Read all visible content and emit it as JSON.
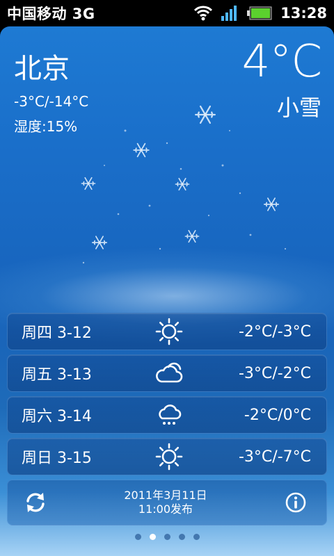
{
  "status_bar": {
    "carrier": "中国移动 3G",
    "time": "13:28",
    "icons": [
      "wifi-icon",
      "signal-icon",
      "battery-icon"
    ]
  },
  "weather": {
    "city": "北京",
    "temp_range": "-3°C/-14°C",
    "humidity": "湿度:15%",
    "current_temp": "4°C",
    "condition": "小雪"
  },
  "forecast": [
    {
      "day": "周四 3-12",
      "icon": "sunny-icon",
      "temp": "-2°C/-3°C"
    },
    {
      "day": "周五 3-13",
      "icon": "cloudy-icon",
      "temp": "-3°C/-2°C"
    },
    {
      "day": "周六 3-14",
      "icon": "rain-icon",
      "temp": "-2°C/0°C"
    },
    {
      "day": "周日 3-15",
      "icon": "sunny-icon",
      "temp": "-3°C/-7°C"
    }
  ],
  "footer": {
    "publish_date": "2011年3月11日",
    "publish_time": "11:00发布",
    "refresh_icon": "refresh-icon",
    "info_icon": "info-icon"
  },
  "pager": {
    "count": 5,
    "active_index": 1
  }
}
